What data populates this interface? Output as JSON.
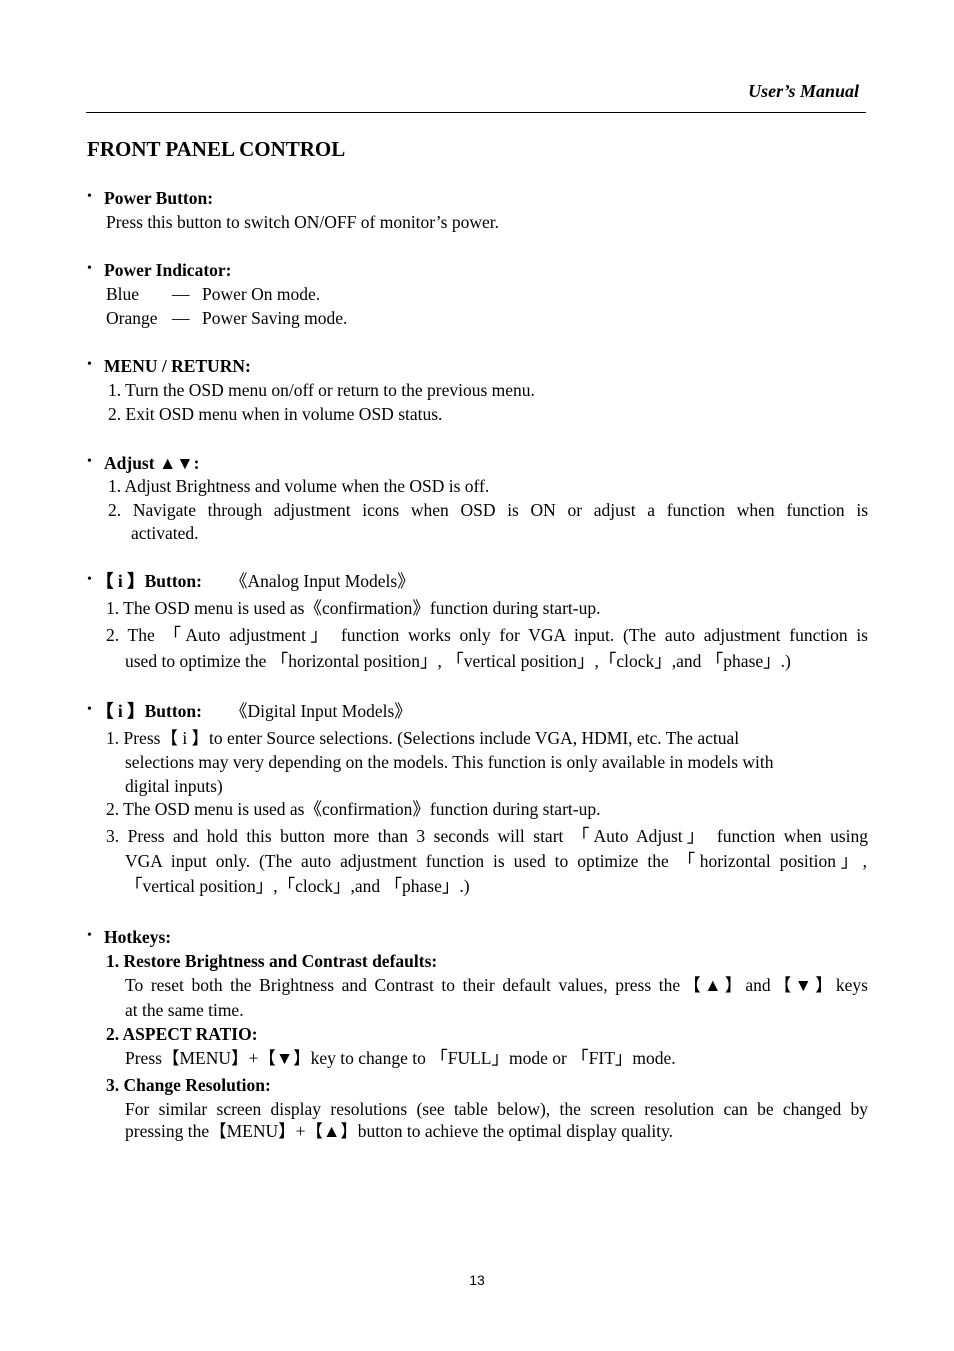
{
  "header": {
    "title": "User’s Manual"
  },
  "page_heading": "FRONT PANEL CONTROL",
  "sections": {
    "power_button": {
      "title": "Power Button:",
      "text": "Press this button to switch ON/OFF of monitor’s power."
    },
    "power_indicator": {
      "title": "Power Indicator:",
      "rows": [
        {
          "color": "Blue",
          "dash": "—",
          "meaning": "Power On mode."
        },
        {
          "color": "Orange",
          "dash": "—",
          "meaning": "Power Saving mode."
        }
      ]
    },
    "menu_return": {
      "title": "MENU / RETURN:",
      "items": [
        "1. Turn the OSD menu on/off or return to the previous menu.",
        "2. Exit OSD menu when in volume OSD status."
      ]
    },
    "adjust": {
      "title": "Adjust ▲▼:",
      "items": [
        "1. Adjust Brightness and volume when the OSD is off.",
        "2. Navigate through adjustment icons when OSD is ON or adjust a function when function is",
        "activated."
      ]
    },
    "i_button_analog": {
      "title_key": "【 i 】Button:",
      "title_note": "《Analog Input Models》",
      "items": [
        "1. The OSD menu is used as《confirmation》function during start-up.",
        "2. The 「Auto adjustment」 function works only for VGA input. (The auto adjustment function is",
        "used to optimize the 「horizontal position」, 「vertical position」,「clock」,and 「phase」.)"
      ]
    },
    "i_button_digital": {
      "title_key": "【 i 】Button:",
      "title_note": "《Digital Input Models》",
      "items": [
        "1. Press【 i 】to enter Source selections. (Selections include VGA, HDMI, etc. The actual",
        "selections may very depending on the models. This function is only available in models with",
        "digital inputs)",
        "2. The OSD menu is used as《confirmation》function during start-up.",
        "3. Press and hold this button more than 3 seconds will start 「Auto Adjust」 function when using",
        "VGA input only. (The auto adjustment function is used to optimize the 「horizontal position」,",
        "「vertical position」,「clock」,and 「phase」.)"
      ]
    },
    "hotkeys": {
      "title": "Hotkeys:",
      "items": [
        {
          "heading": "1. Restore Brightness and Contrast defaults:",
          "lines": [
            "To reset both the Brightness and Contrast to their default values, press the【▲】and【▼】keys",
            "at the same time."
          ]
        },
        {
          "heading": "2. ASPECT RATIO:",
          "lines": [
            "Press【MENU】+【▼】key to change to 「FULL」mode or 「FIT」mode."
          ]
        },
        {
          "heading": "3. Change Resolution:",
          "lines": [
            "For similar screen display resolutions (see table below), the screen resolution can be changed by",
            "pressing the【MENU】+【▲】button to achieve the optimal display quality."
          ]
        }
      ]
    }
  },
  "bullet_glyph": "•",
  "page_number": "13"
}
